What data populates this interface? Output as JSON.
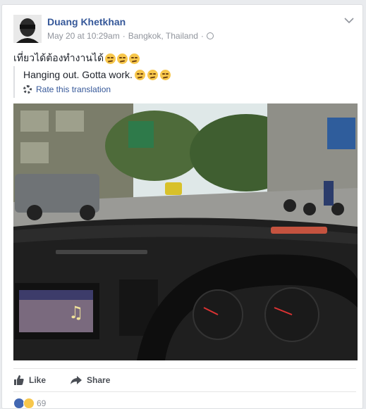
{
  "post": {
    "author": "Duang Khetkhan",
    "date": "May 20 at 10:29am",
    "separator": "·",
    "location": "Bangkok, Thailand",
    "separator2": "·",
    "text": "เที่ยวได้ต้องทำงานได้",
    "emoji_name": "unamused-face"
  },
  "translation": {
    "text": "Hanging out. Gotta work.",
    "rate_label": "Rate this translation"
  },
  "actions": {
    "like_label": "Like",
    "share_label": "Share"
  },
  "reactions": {
    "count": "69",
    "types": [
      "like-icon",
      "haha-icon"
    ]
  },
  "colors": {
    "link_blue": "#365899",
    "meta_gray": "#90949c",
    "like_blue": "#4267b2",
    "haha_yellow": "#f7c74c"
  }
}
